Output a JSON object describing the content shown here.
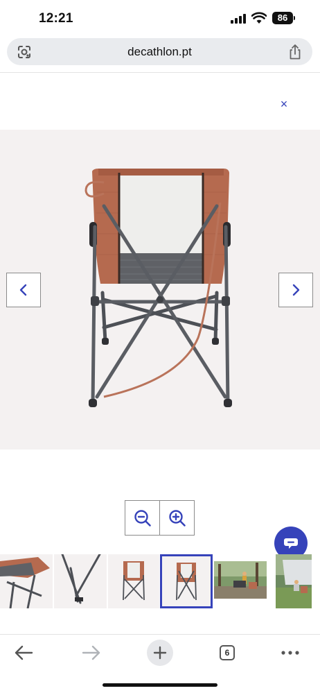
{
  "status_bar": {
    "time": "12:21",
    "battery": "86"
  },
  "browser": {
    "url": "decathlon.pt",
    "open_tabs": "6"
  },
  "gallery": {
    "close_label": "×",
    "prev_label": "‹",
    "next_label": "›",
    "selected_thumbnail": 3,
    "thumbnail_count": 6
  },
  "colors": {
    "accent": "#3643ba",
    "image_bg": "#f4f1f1",
    "chair_fabric": "#b56a4f",
    "chair_frame": "#5a5d63",
    "mesh": "#eeeeec"
  },
  "icons": {
    "lens": "google-lens-icon",
    "share": "share-icon",
    "close": "close-icon",
    "prev": "chevron-left-icon",
    "next": "chevron-right-icon",
    "zoom_out": "zoom-out-icon",
    "zoom_in": "zoom-in-icon",
    "chat": "chat-icon",
    "back": "arrow-left-icon",
    "forward": "arrow-right-icon",
    "new_tab": "plus-icon",
    "tabs": "tabs-icon",
    "more": "more-icon"
  }
}
